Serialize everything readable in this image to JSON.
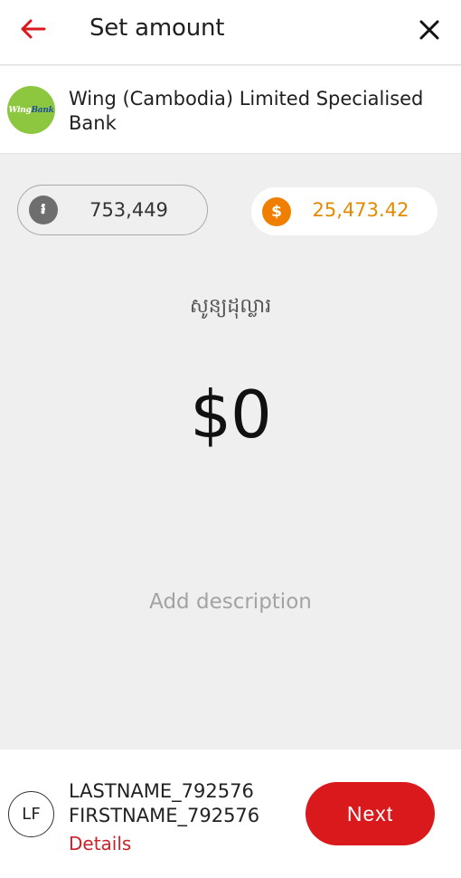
{
  "header": {
    "title": "Set amount",
    "back_icon": "arrow-left-icon",
    "close_icon": "close-icon",
    "accent_color": "#d9191c"
  },
  "bank": {
    "name": "Wing (Cambodia) Limited Specialised Bank",
    "logo_text_w": "Wing",
    "logo_text_b": "Bank"
  },
  "balances": {
    "khr": {
      "value": "753,449",
      "icon": "riel-coin-icon",
      "symbol": "៛"
    },
    "usd": {
      "value": "25,473.42",
      "icon": "dollar-coin-icon",
      "symbol": "$",
      "color": "#e58a00"
    }
  },
  "amount": {
    "currency_label": "សូន្យដុល្លារ",
    "value": "$0"
  },
  "description": {
    "placeholder": "Add description"
  },
  "payee": {
    "initials": "LF",
    "name": "LASTNAME_792576\nFIRSTNAME_792576",
    "details_label": "Details"
  },
  "actions": {
    "next_label": "Next"
  }
}
